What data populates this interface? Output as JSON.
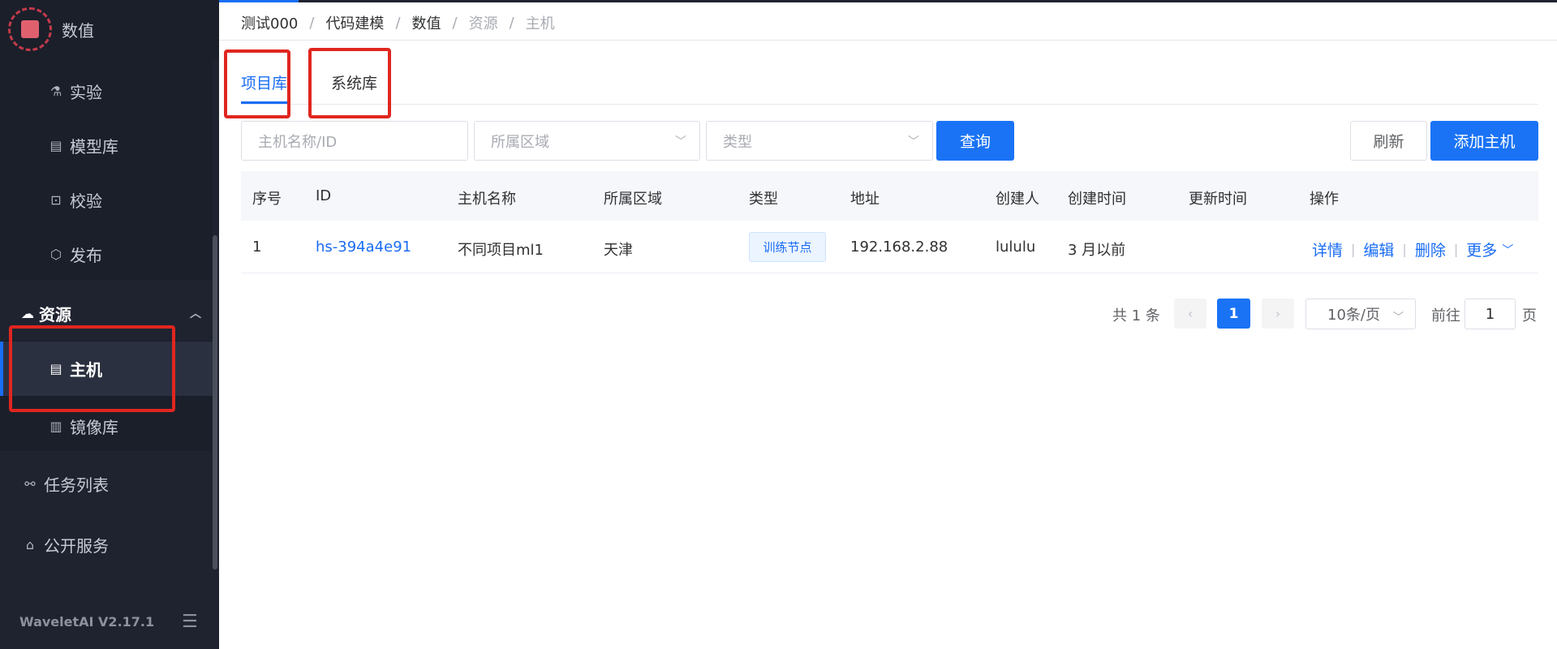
{
  "app": {
    "title": "数值",
    "version": "WaveletAI V2.17.1",
    "accent": "#1a6df5"
  },
  "sidebar": {
    "sub_items": [
      {
        "label": "实验",
        "icon": "experiment-icon"
      },
      {
        "label": "模型库",
        "icon": "model-library-icon"
      },
      {
        "label": "校验",
        "icon": "validate-icon"
      },
      {
        "label": "发布",
        "icon": "publish-icon"
      }
    ],
    "resources": {
      "label": "资源",
      "icon": "cloud-icon",
      "items": [
        {
          "label": "主机",
          "icon": "server-icon",
          "active": true
        },
        {
          "label": "镜像库",
          "icon": "image-registry-icon",
          "active": false
        }
      ]
    },
    "bottom_items": [
      {
        "label": "任务列表",
        "icon": "task-list-icon"
      },
      {
        "label": "公开服务",
        "icon": "public-service-icon"
      }
    ]
  },
  "breadcrumb": [
    "测试000",
    "代码建模",
    "数值",
    "资源",
    "主机"
  ],
  "tabs": [
    {
      "label": "项目库",
      "active": true
    },
    {
      "label": "系统库",
      "active": false
    }
  ],
  "filters": {
    "name_placeholder": "主机名称/ID",
    "region_placeholder": "所属区域",
    "type_placeholder": "类型",
    "query_label": "查询",
    "refresh_label": "刷新",
    "add_label": "添加主机"
  },
  "table": {
    "columns": [
      "序号",
      "ID",
      "主机名称",
      "所属区域",
      "类型",
      "地址",
      "创建人",
      "创建时间",
      "更新时间",
      "操作"
    ],
    "rows": [
      {
        "index": "1",
        "id": "hs-394a4e91",
        "name": "不同项目ml1",
        "region": "天津",
        "type": "训练节点",
        "address": "192.168.2.88",
        "creator": "lululu",
        "created": "3 月以前",
        "updated": "",
        "actions": [
          "详情",
          "编辑",
          "删除",
          "更多"
        ]
      }
    ]
  },
  "pagination": {
    "total_text": "共 1 条",
    "current_page": "1",
    "page_size": "10条/页",
    "goto_prefix": "前往",
    "goto_value": "1",
    "goto_suffix": "页"
  }
}
